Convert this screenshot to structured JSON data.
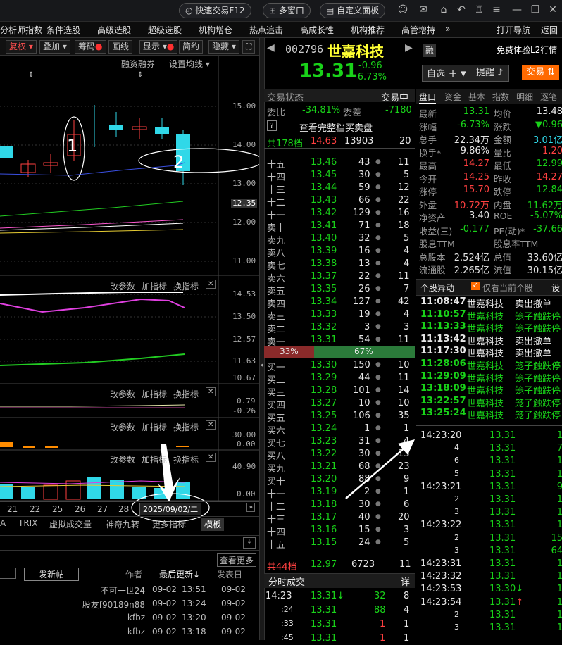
{
  "topbar": {
    "quick_trade": "快速交易F12",
    "multi_window": "多窗口",
    "custom_panel": "自定义面板"
  },
  "menu": [
    "分析师指数",
    "条件选股",
    "高级选股",
    "超级选股",
    "机构增仓",
    "热点追击",
    "高成长性",
    "机构推荐",
    "高管增持",
    "»",
    "打开导航",
    "返回"
  ],
  "chart_toolbar": [
    "复权",
    "叠加",
    "筹码",
    "画线",
    "显示",
    "简约",
    "隐藏"
  ],
  "chart_labels": {
    "margin": "融资融券",
    "ma": "设置均线",
    "params": "改参数",
    "add_ind": "加指标",
    "change_ind": "换指标"
  },
  "price_axis": [
    "15.00",
    "14.00",
    "13.00",
    "12.35",
    "12.00",
    "11.00"
  ],
  "ind1_axis": [
    "14.53",
    "13.50",
    "12.57",
    "11.63",
    "10.67"
  ],
  "ind2_axis": [
    "0.79",
    "-0.26"
  ],
  "ind3_axis": [
    "30.00",
    "0.00"
  ],
  "ind4_axis": [
    "40.90",
    "0.00"
  ],
  "dates": [
    "21",
    "22",
    "25",
    "26",
    "27",
    "28"
  ],
  "date_cursor": "2025/09/02/二",
  "bottom_tabs": [
    "A",
    "TRIX",
    "虚拟成交量",
    "神奇九转",
    "更多指标",
    "模板"
  ],
  "forum": {
    "post_button": "发新帖",
    "author": "作者",
    "last_update": "最后更新↓",
    "publish": "发表日",
    "more": "查看更多",
    "rows": [
      {
        "author": "不可一世24",
        "date": "09-02",
        "time": "13:51",
        "pub": "09-02"
      },
      {
        "author": "股友f90189n88",
        "date": "09-02",
        "time": "13:24",
        "pub": "09-02"
      },
      {
        "author": "kfbz",
        "date": "09-02",
        "time": "13:20",
        "pub": "09-02"
      },
      {
        "author": "kfbz",
        "date": "09-02",
        "time": "13:18",
        "pub": "09-02"
      }
    ]
  },
  "annotations": {
    "one": "1",
    "two": "2"
  },
  "stock": {
    "code": "002796",
    "name": "世嘉科技",
    "price": "13.31",
    "change": "-0.96",
    "pct": "-6.73%",
    "badge": "融",
    "l2": "免费体验L2行情"
  },
  "buttons": {
    "watch": "自选",
    "remind": "提醒",
    "trade": "交易"
  },
  "trade_status": {
    "label": "交易状态",
    "value": "交易中"
  },
  "ratio": {
    "wb_label": "委比",
    "wb": "-34.81%",
    "wc_label": "委差",
    "wc": "-7180"
  },
  "full_depth": "查看完整档买卖盘",
  "total_ask": {
    "label": "共178档",
    "price": "14.63",
    "vol": "13903",
    "cnt": "20"
  },
  "asks": [
    [
      "十五",
      "13.46",
      "43",
      "11"
    ],
    [
      "十四",
      "13.45",
      "30",
      "5"
    ],
    [
      "十三",
      "13.44",
      "59",
      "12"
    ],
    [
      "十二",
      "13.43",
      "66",
      "22"
    ],
    [
      "十一",
      "13.42",
      "129",
      "16"
    ],
    [
      "卖十",
      "13.41",
      "71",
      "18"
    ],
    [
      "卖九",
      "13.40",
      "32",
      "5"
    ],
    [
      "卖八",
      "13.39",
      "16",
      "4"
    ],
    [
      "卖七",
      "13.38",
      "13",
      "4"
    ],
    [
      "卖六",
      "13.37",
      "22",
      "11"
    ],
    [
      "卖五",
      "13.35",
      "26",
      "7"
    ],
    [
      "卖四",
      "13.34",
      "127",
      "42"
    ],
    [
      "卖三",
      "13.33",
      "19",
      "4"
    ],
    [
      "卖二",
      "13.32",
      "3",
      "3"
    ],
    [
      "卖一",
      "13.31",
      "54",
      "11"
    ]
  ],
  "ratio_bar": {
    "sell": "33%",
    "buy": "67%",
    "sell_frac": 0.33
  },
  "bids": [
    [
      "买一",
      "13.30",
      "150",
      "10"
    ],
    [
      "买二",
      "13.29",
      "44",
      "11"
    ],
    [
      "买三",
      "13.28",
      "101",
      "14"
    ],
    [
      "买四",
      "13.27",
      "10",
      "10"
    ],
    [
      "买五",
      "13.25",
      "106",
      "35"
    ],
    [
      "买六",
      "13.24",
      "1",
      "1"
    ],
    [
      "买七",
      "13.23",
      "31",
      "4"
    ],
    [
      "买八",
      "13.22",
      "30",
      "13"
    ],
    [
      "买九",
      "13.21",
      "68",
      "23"
    ],
    [
      "买十",
      "13.20",
      "88",
      "9"
    ],
    [
      "十一",
      "13.19",
      "2",
      "1"
    ],
    [
      "十二",
      "13.18",
      "30",
      "6"
    ],
    [
      "十三",
      "13.17",
      "40",
      "20"
    ],
    [
      "十四",
      "13.16",
      "15",
      "3"
    ],
    [
      "十五",
      "13.15",
      "24",
      "5"
    ]
  ],
  "total_bid": {
    "label": "共44档",
    "price": "12.97",
    "vol": "6723",
    "cnt": "11"
  },
  "tick_header": {
    "label": "分时成交",
    "detail": "详"
  },
  "ticks": [
    {
      "time": "14:23",
      "price": "13.31",
      "dir": "↓",
      "vol": "32",
      "n": "8",
      "vc": "green"
    },
    {
      "time": ":24",
      "price": "13.31",
      "dir": "",
      "vol": "88",
      "n": "4",
      "vc": "green"
    },
    {
      "time": ":33",
      "price": "13.31",
      "dir": "",
      "vol": "1",
      "n": "1",
      "vc": "red"
    },
    {
      "time": ":45",
      "price": "13.31",
      "dir": "",
      "vol": "1",
      "n": "1",
      "vc": "red"
    }
  ],
  "tabs": [
    "盘口",
    "资金",
    "基本",
    "指数",
    "明细",
    "逐笔"
  ],
  "stats": [
    [
      "最新",
      "13.31",
      "均价",
      "13.48"
    ],
    [
      "涨幅",
      "-6.73%",
      "涨跌",
      "▼0.96"
    ],
    [
      "总手",
      "22.34万",
      "金额",
      "3.01亿"
    ],
    [
      "换手*",
      "9.86%",
      "量比",
      "1.20"
    ],
    [
      "最高",
      "14.27",
      "最低",
      "12.99"
    ],
    [
      "今开",
      "14.25",
      "昨收",
      "14.27"
    ],
    [
      "涨停",
      "15.70",
      "跌停",
      "12.84"
    ],
    [
      "外盘",
      "10.72万",
      "内盘",
      "11.62万"
    ],
    [
      "净资产",
      "3.40",
      "ROE",
      "-5.07%"
    ],
    [
      "收益(三)",
      "-0.177",
      "PE(动)*",
      "-37.66"
    ],
    [
      "股息TTM",
      "—",
      "股息率TTM",
      "—"
    ],
    [
      "总股本",
      "2.524亿",
      "总值",
      "33.60亿"
    ],
    [
      "流通股",
      "2.265亿",
      "流值",
      "30.15亿"
    ]
  ],
  "anomaly": {
    "title": "个股异动",
    "only_current": "仅看当前个股",
    "settings": "设"
  },
  "anomalies": [
    {
      "time": "11:08:47",
      "name": "世嘉科技",
      "event": "卖出撤单",
      "c": "white"
    },
    {
      "time": "11:10:57",
      "name": "世嘉科技",
      "event": "笼子触跌停",
      "c": "green"
    },
    {
      "time": "11:13:33",
      "name": "世嘉科技",
      "event": "笼子触跌停",
      "c": "green"
    },
    {
      "time": "11:13:42",
      "name": "世嘉科技",
      "event": "卖出撤单",
      "c": "white"
    },
    {
      "time": "11:17:30",
      "name": "世嘉科技",
      "event": "卖出撤单",
      "c": "white"
    },
    {
      "time": "11:28:06",
      "name": "世嘉科技",
      "event": "笼子触跌停",
      "c": "green"
    },
    {
      "time": "11:29:09",
      "name": "世嘉科技",
      "event": "笼子触跌停",
      "c": "green"
    },
    {
      "time": "13:18:09",
      "name": "世嘉科技",
      "event": "笼子触跌停",
      "c": "green"
    },
    {
      "time": "13:22:57",
      "name": "世嘉科技",
      "event": "笼子触跌停",
      "c": "green"
    },
    {
      "time": "13:25:24",
      "name": "世嘉科技",
      "event": "笼子触跌停",
      "c": "green"
    }
  ],
  "detail": [
    {
      "t": "14:23:20",
      "p": "13.31",
      "v": "1"
    },
    {
      "t": "4",
      "p": "13.31",
      "v": "7"
    },
    {
      "t": "6",
      "p": "13.31",
      "v": "1"
    },
    {
      "t": "5",
      "p": "13.31",
      "v": "1"
    },
    {
      "t": "14:23:21",
      "p": "13.31",
      "v": "9"
    },
    {
      "t": "2",
      "p": "13.31",
      "v": "1"
    },
    {
      "t": "3",
      "p": "13.31",
      "v": "1"
    },
    {
      "t": "14:23:22",
      "p": "13.31",
      "v": "1"
    },
    {
      "t": "2",
      "p": "13.31",
      "v": "15"
    },
    {
      "t": "3",
      "p": "13.31",
      "v": "64"
    },
    {
      "t": "14:23:31",
      "p": "13.31",
      "v": "1"
    },
    {
      "t": "14:23:32",
      "p": "13.31",
      "v": "1"
    },
    {
      "t": "14:23:53",
      "p": "13.30↓",
      "v": "1"
    },
    {
      "t": "14:23:54",
      "p": "13.31↑",
      "v": "1"
    },
    {
      "t": "2",
      "p": "13.31",
      "v": "1"
    },
    {
      "t": "3",
      "p": "13.31",
      "v": "1"
    }
  ]
}
